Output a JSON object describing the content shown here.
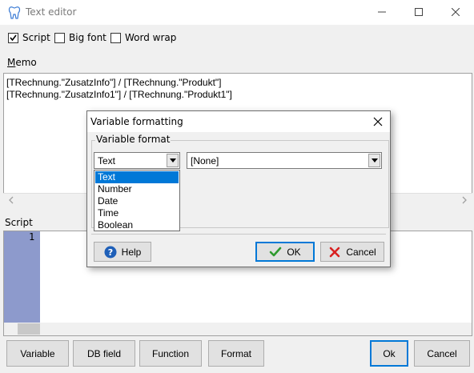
{
  "window": {
    "title": "Text editor"
  },
  "options": {
    "script": "Script",
    "big_font": "Big font",
    "word_wrap": "Word wrap"
  },
  "memo": {
    "label": "Memo",
    "lines": [
      "[TRechnung.\"ZusatzInfo\"] / [TRechnung.\"Produkt\"]",
      "[TRechnung.\"ZusatzInfo1\"] / [TRechnung.\"Produkt1\"]"
    ]
  },
  "script": {
    "label": "Script",
    "line_numbers": [
      "1"
    ]
  },
  "buttons": {
    "variable": "Variable",
    "db_field": "DB field",
    "function": "Function",
    "format": "Format",
    "ok": "Ok",
    "cancel": "Cancel"
  },
  "dialog": {
    "title": "Variable formatting",
    "group_label": "Variable format",
    "type_value": "Text",
    "format_value": "[None]",
    "type_options": [
      "Text",
      "Number",
      "Date",
      "Time",
      "Boolean"
    ],
    "selected_index": 0,
    "help": "Help",
    "ok": "OK",
    "cancel": "Cancel"
  },
  "colors": {
    "accent": "#0078d7",
    "gutter": "#8d9acc",
    "ok_check": "#2e9a2e",
    "cancel_x": "#d82020",
    "help_icon": "#1e5fb8"
  }
}
